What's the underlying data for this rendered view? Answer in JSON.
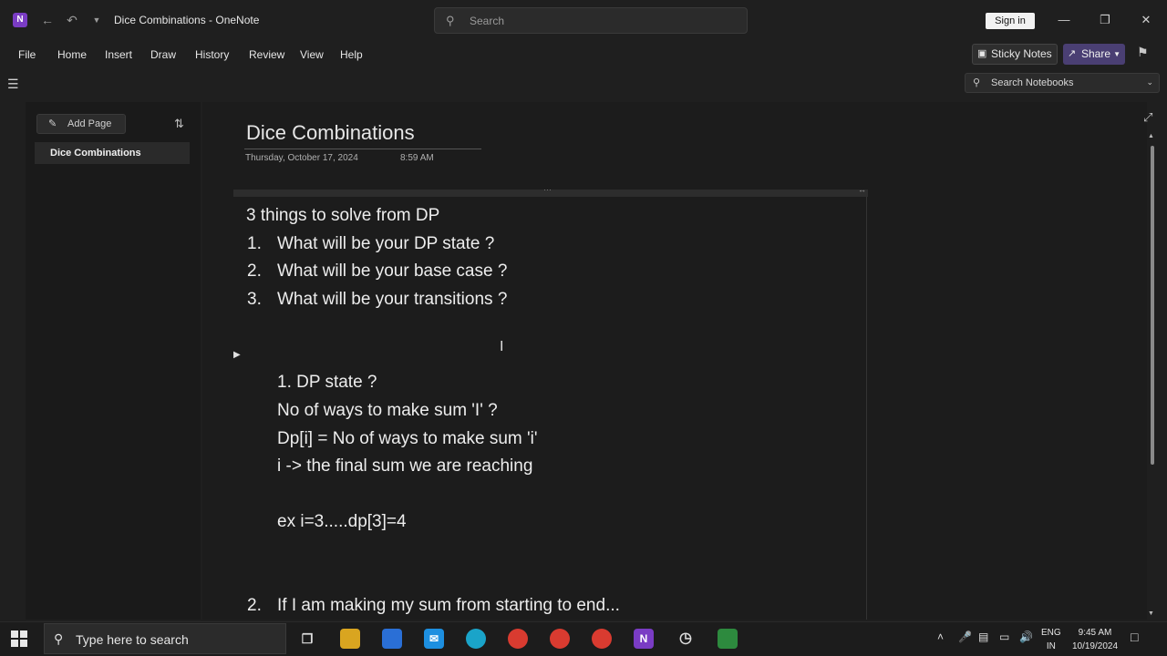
{
  "window": {
    "title": "Dice Combinations - OneNote",
    "search_placeholder": "Search",
    "sign_in": "Sign in",
    "app_logo": "N"
  },
  "menu": [
    "File",
    "Home",
    "Insert",
    "Draw",
    "History",
    "Review",
    "View",
    "Help"
  ],
  "toolbar": {
    "sticky_notes": "Sticky Notes",
    "share": "Share",
    "search_notebooks": "Search Notebooks"
  },
  "sidebar": {
    "add_page": "Add Page",
    "pages": [
      "Dice Combinations"
    ]
  },
  "page": {
    "title": "Dice Combinations",
    "date": "Thursday, October 17, 2024",
    "time": "8:59 AM",
    "lines": {
      "heading": "3 things to solve from DP",
      "item1_num": "1.",
      "item1": "What will be your DP state ?",
      "item2_num": "2.",
      "item2": "What will be your base case ?",
      "item3_num": "3.",
      "item3": "What will be your transitions ?",
      "sub1": "1. DP state ?",
      "sub2": "No of ways to make sum 'I' ?",
      "sub3": "Dp[i] = No of ways to make sum 'i'",
      "sub4": "i -> the final sum we are reaching",
      "example": "ex i=3.....dp[3]=4",
      "next_num": "2.",
      "next": "If I am making my sum from starting to end..."
    }
  },
  "taskbar": {
    "search_placeholder": "Type here to search",
    "lang_line1": "ENG",
    "lang_line2": "IN",
    "time": "9:45 AM",
    "date": "10/19/2024"
  },
  "icons": {
    "back": "back-arrow-icon",
    "undo": "undo-icon",
    "search": "search-icon",
    "minimize": "minimize-icon",
    "restore": "restore-icon",
    "close": "close-icon"
  },
  "colors": {
    "onenote_purple": "#7a3cc4",
    "share_purple": "#4a3f73",
    "background": "#1c1c1c"
  }
}
